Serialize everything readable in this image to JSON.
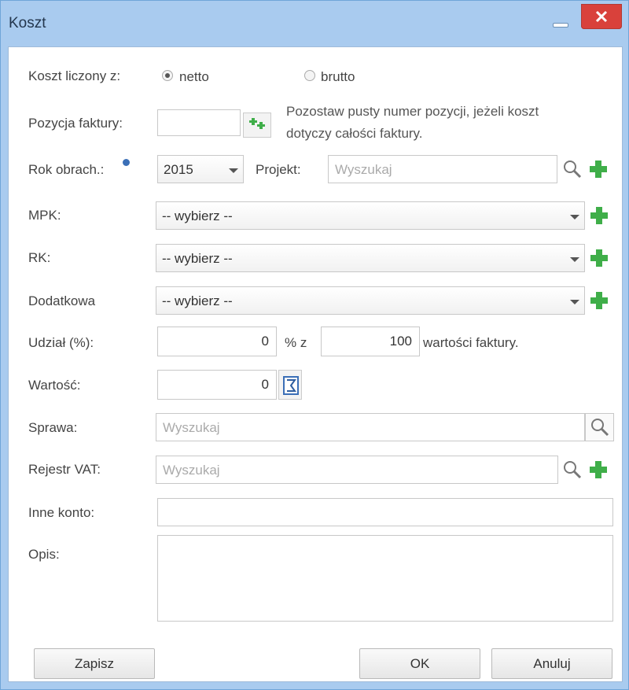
{
  "dialog": {
    "title": "Koszt"
  },
  "form": {
    "koszt_label": "Koszt liczony z:",
    "netto": "netto",
    "brutto": "brutto",
    "selected_basis": "netto",
    "pozycja_label": "Pozycja faktury:",
    "pozycja_value": "",
    "pozycja_help_line1": "Pozostaw pusty numer pozycji, jeżeli koszt",
    "pozycja_help_line2": "dotyczy całości faktury.",
    "rok_label": "Rok obrach.:",
    "rok_value": "2015",
    "projekt_label": "Projekt:",
    "projekt_placeholder": "Wyszukaj",
    "mpk_label": "MPK:",
    "mpk_value": "-- wybierz --",
    "rk_label": "RK:",
    "rk_value": "-- wybierz --",
    "dodatkowa_label": "Dodatkowa",
    "dodatkowa_value": "-- wybierz --",
    "udzial_label": "Udział (%):",
    "udzial_value": "0",
    "percent_z": "% z",
    "total_value": "100",
    "wartosci_faktury": "wartości faktury.",
    "wartosc_label": "Wartość:",
    "wartosc_value": "0",
    "sprawa_label": "Sprawa:",
    "sprawa_placeholder": "Wyszukaj",
    "rejestr_label": "Rejestr VAT:",
    "rejestr_placeholder": "Wyszukaj",
    "inne_label": "Inne konto:",
    "inne_value": "",
    "opis_label": "Opis:",
    "opis_value": ""
  },
  "buttons": {
    "zapisz": "Zapisz",
    "ok": "OK",
    "anuluj": "Anuluj"
  },
  "icons": {
    "add": "plus-icon",
    "search": "search-icon",
    "sum": "sigma-icon"
  },
  "colors": {
    "titlebar": "#a9cbef",
    "close": "#d9413b",
    "plus": "#3fae49"
  }
}
